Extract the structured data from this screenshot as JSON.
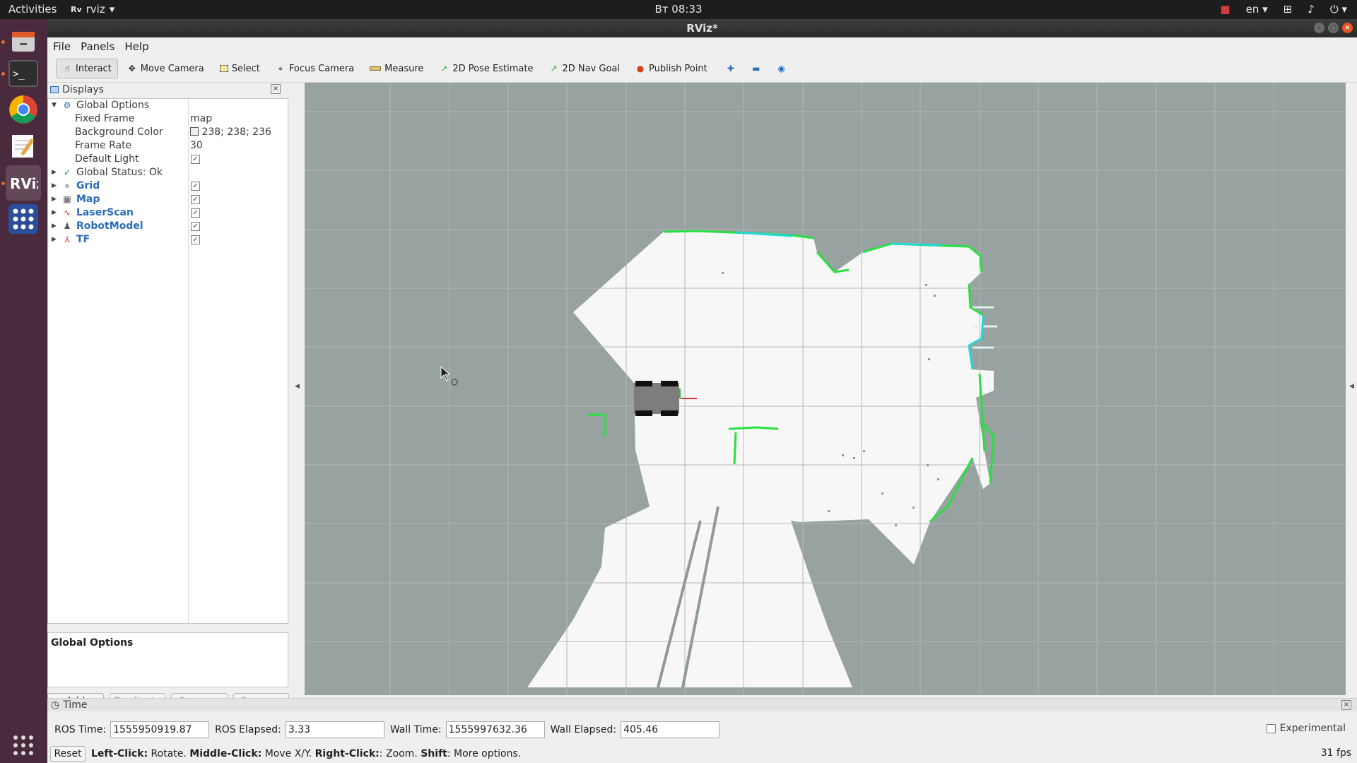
{
  "topbar": {
    "activities": "Activities",
    "app_name": "rviz",
    "clock": "Вт 08:33",
    "lang": "en"
  },
  "window": {
    "title": "RViz*"
  },
  "menu": {
    "file": "File",
    "panels": "Panels",
    "help": "Help"
  },
  "toolbar": {
    "interact": "Interact",
    "move_camera": "Move Camera",
    "select": "Select",
    "focus_camera": "Focus Camera",
    "measure": "Measure",
    "pose_estimate": "2D Pose Estimate",
    "nav_goal": "2D Nav Goal",
    "publish_point": "Publish Point"
  },
  "displays": {
    "title": "Displays",
    "global_options": "Global Options",
    "fixed_frame_label": "Fixed Frame",
    "fixed_frame_value": "map",
    "bg_color_label": "Background Color",
    "bg_color_value": "238; 238; 236",
    "frame_rate_label": "Frame Rate",
    "frame_rate_value": "30",
    "default_light_label": "Default Light",
    "global_status": "Global Status: Ok",
    "items": [
      "Grid",
      "Map",
      "LaserScan",
      "RobotModel",
      "TF"
    ],
    "description_title": "Global Options",
    "buttons": {
      "add": "Add",
      "duplicate": "Duplicate",
      "remove": "Remove",
      "rename": "Rename"
    }
  },
  "time": {
    "title": "Time",
    "ros_time_label": "ROS Time:",
    "ros_time": "1555950919.87",
    "ros_elapsed_label": "ROS Elapsed:",
    "ros_elapsed": "3.33",
    "wall_time_label": "Wall Time:",
    "wall_time": "1555997632.36",
    "wall_elapsed_label": "Wall Elapsed:",
    "wall_elapsed": "405.46",
    "experimental": "Experimental"
  },
  "status": {
    "reset": "Reset",
    "left_click": "Left-Click:",
    "left_action": " Rotate. ",
    "middle_click": "Middle-Click:",
    "middle_action": " Move X/Y. ",
    "right_click": "Right-Click:",
    "right_action": ": Zoom. ",
    "shift": "Shift",
    "shift_action": ": More options.",
    "fps": "31 fps"
  },
  "colors": {
    "viewport_bg": "#97a2a1",
    "free_space": "#f7f7f7",
    "laser_green": "#27e041",
    "laser_cyan": "#22d9d9",
    "accent_blue": "#2a6cb8"
  }
}
